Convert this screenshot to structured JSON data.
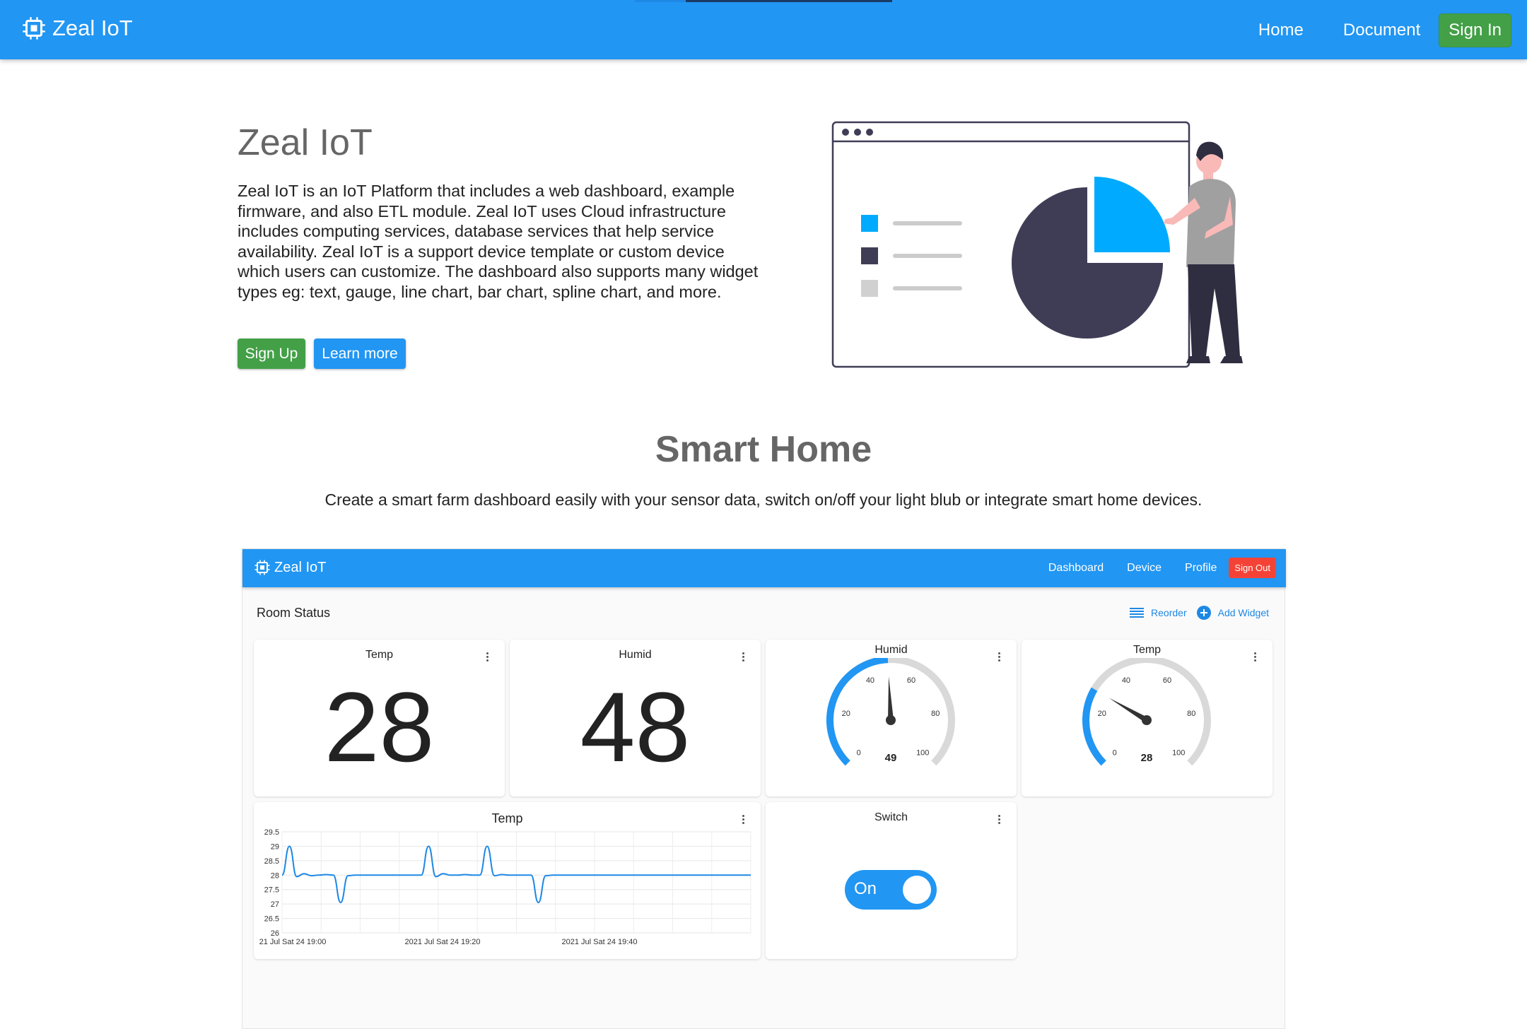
{
  "app": {
    "brand": "Zeal IoT",
    "nav": {
      "home": "Home",
      "document": "Document",
      "sign_in": "Sign In"
    }
  },
  "hero": {
    "title": "Zeal IoT",
    "description": "Zeal IoT is an IoT Platform that includes a web dashboard, example firmware, and also ETL module. Zeal IoT uses Cloud infrastructure includes computing services, database services that help service availability. Zeal IoT is a support device template or custom device which users can customize. The dashboard also supports many widget types eg: text, gauge, line chart, bar chart, spline chart, and more.",
    "sign_up": "Sign Up",
    "learn_more": "Learn more"
  },
  "section": {
    "title": "Smart Home",
    "subtitle": "Create a smart farm dashboard easily with your sensor data, switch on/off your light blub or integrate smart home devices."
  },
  "dashboard": {
    "brand": "Zeal IoT",
    "nav": {
      "dashboard": "Dashboard",
      "device": "Device",
      "profile": "Profile",
      "sign_out": "Sign Out"
    },
    "room_title": "Room Status",
    "reorder": "Reorder",
    "add_widget": "Add Widget",
    "widgets": {
      "temp_text": {
        "title": "Temp",
        "value": "28"
      },
      "humid_text": {
        "title": "Humid",
        "value": "48"
      },
      "humid_gauge": {
        "title": "Humid",
        "value": 49,
        "min": 0,
        "max": 100,
        "ticks": [
          "0",
          "20",
          "40",
          "60",
          "80",
          "100"
        ]
      },
      "temp_gauge": {
        "title": "Temp",
        "value": 28,
        "min": 0,
        "max": 100,
        "ticks": [
          "0",
          "20",
          "40",
          "60",
          "80",
          "100"
        ]
      },
      "temp_chart": {
        "title": "Temp"
      },
      "switch": {
        "title": "Switch",
        "state": "On"
      }
    }
  },
  "colors": {
    "primary": "#2196f3",
    "success": "#43a047",
    "danger": "#f44336",
    "pie_dark": "#3f3d56",
    "pie_accent": "#00aaff"
  },
  "chart_data": {
    "type": "line",
    "yticks": [
      "29.5",
      "29",
      "28.5",
      "28",
      "27.5",
      "27",
      "26.5",
      "26"
    ],
    "ylim": [
      26,
      29.5
    ],
    "xtick_labels": [
      "21 Jul Sat 24 19:00",
      "2021 Jul Sat 24 19:20",
      "2021 Jul Sat 24 19:40"
    ],
    "series": [
      {
        "values": [
          28,
          29,
          27.95,
          28.05,
          27.98,
          28,
          28.02,
          28,
          27.05,
          27.98,
          28,
          28,
          28,
          28,
          28,
          28,
          28,
          28,
          28,
          28,
          29,
          27.95,
          28.05,
          28,
          28,
          28.02,
          28,
          28,
          29,
          27.98,
          28.02,
          28,
          28,
          28,
          28,
          27.05,
          27.98,
          28,
          28,
          28,
          28,
          28,
          28,
          28,
          28,
          28,
          28,
          28,
          28,
          28,
          28,
          28,
          28,
          28,
          28,
          28,
          28,
          28,
          28,
          28,
          28,
          28,
          28,
          28,
          28
        ]
      }
    ]
  }
}
